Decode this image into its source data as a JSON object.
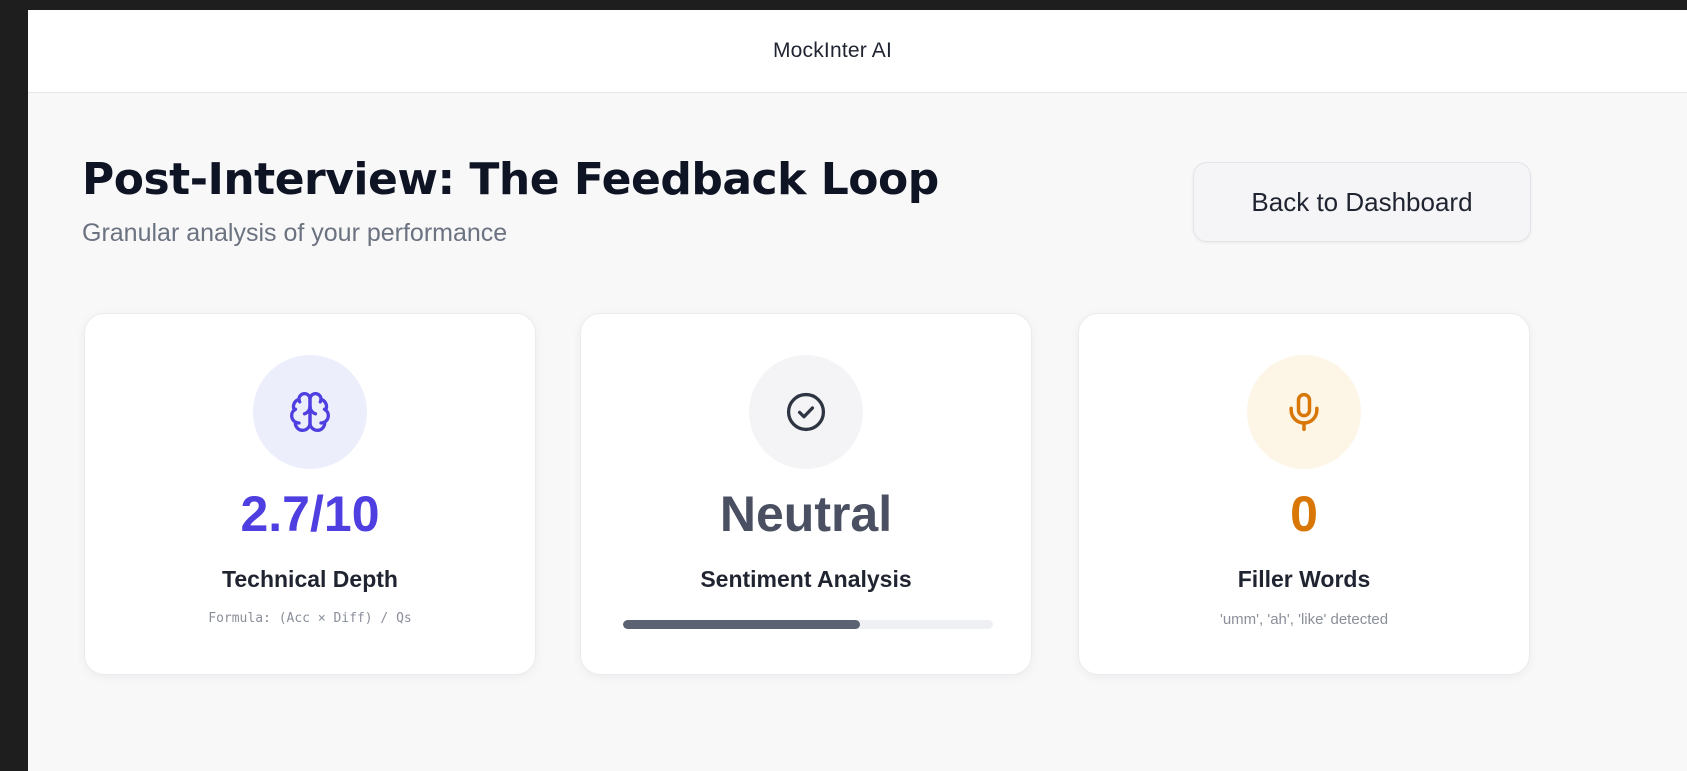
{
  "app": {
    "title": "MockInter AI"
  },
  "header": {
    "title": "Post-Interview: The Feedback Loop",
    "subtitle": "Granular analysis of your performance",
    "back_button_label": "Back to Dashboard"
  },
  "cards": [
    {
      "icon": "brain-icon",
      "value": "2.7/10",
      "label": "Technical Depth",
      "caption": "Formula: (Acc × Diff) / Qs",
      "value_color": "#4f3fe0",
      "icon_bg": "#eceefc"
    },
    {
      "icon": "check-circle-icon",
      "value": "Neutral",
      "label": "Sentiment Analysis",
      "progress": 0.64,
      "value_color": "#4a5062",
      "icon_bg": "#f4f4f6"
    },
    {
      "icon": "microphone-icon",
      "value": "0",
      "label": "Filler Words",
      "caption": "'umm', 'ah', 'like' detected",
      "value_color": "#d97706",
      "icon_bg": "#fdf6e7"
    }
  ]
}
